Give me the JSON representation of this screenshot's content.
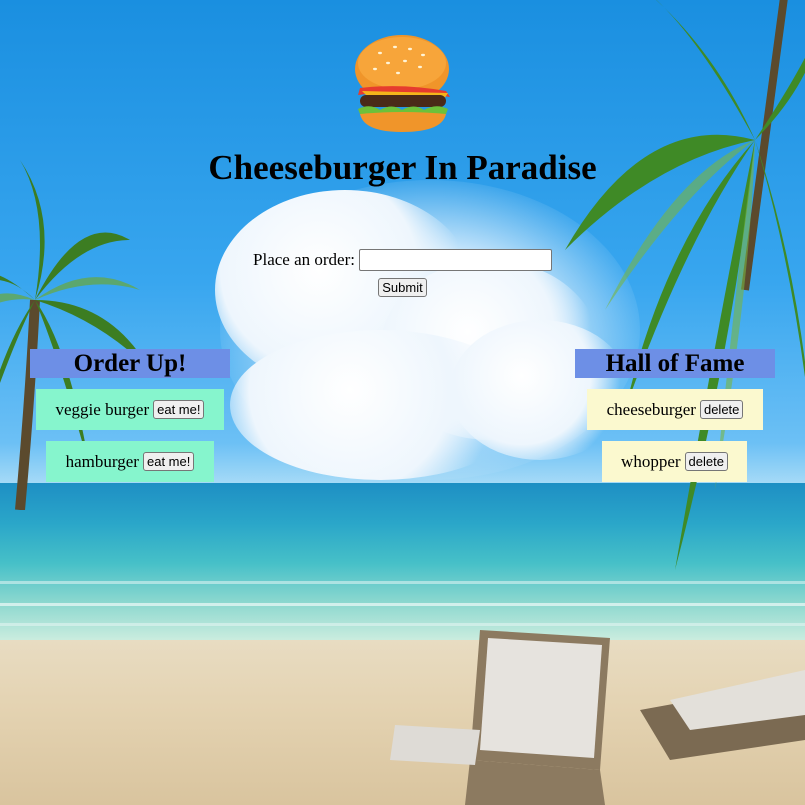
{
  "page": {
    "title": "Cheeseburger In Paradise"
  },
  "order_form": {
    "label": "Place an order:",
    "input_value": "",
    "input_placeholder": "",
    "submit_label": "Submit"
  },
  "orders": {
    "heading": "Order Up!",
    "items": [
      {
        "name": "veggie burger",
        "button": "eat me!"
      },
      {
        "name": "hamburger",
        "button": "eat me!"
      }
    ]
  },
  "hall_of_fame": {
    "heading": "Hall of Fame",
    "items": [
      {
        "name": "cheeseburger",
        "button": "delete"
      },
      {
        "name": "whopper",
        "button": "delete"
      }
    ]
  },
  "icons": {
    "logo": "cheeseburger-icon"
  },
  "colors": {
    "header_bg": "#6d8fe6",
    "order_card_bg": "#86f5cd",
    "fame_card_bg": "#fbf9cf"
  }
}
